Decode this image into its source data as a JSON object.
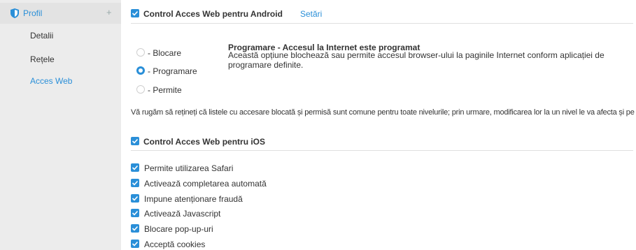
{
  "sidebar": {
    "title": "Profil",
    "plus": "+",
    "items": [
      {
        "label": "Detalii"
      },
      {
        "label": "Rețele"
      },
      {
        "label": "Acces Web"
      }
    ]
  },
  "android": {
    "title": "Control Acces Web pentru Android",
    "settings_link": "Setări",
    "radios": [
      {
        "label": "- Blocare",
        "selected": false
      },
      {
        "label": "- Programare",
        "selected": true
      },
      {
        "label": "- Permite",
        "selected": false
      }
    ],
    "schedule_title": "Programare - Accesul la Internet este programat",
    "schedule_desc": "Această opțiune blochează sau permite accesul browser-ului la paginile Internet conform aplicației de programare definite.",
    "note": "Vă rugăm să rețineți că listele cu accesare blocată și permisă sunt comune pentru toate nivelurile; prin urmare, modificarea lor la un nivel le va afecta și pe celelalte."
  },
  "ios": {
    "title": "Control Acces Web pentru iOS",
    "options": [
      {
        "label": "Permite utilizarea Safari",
        "checked": true
      },
      {
        "label": "Activează completarea automată",
        "checked": true
      },
      {
        "label": "Impune atenționare fraudă",
        "checked": true
      },
      {
        "label": "Activează Javascript",
        "checked": true
      },
      {
        "label": "Blocare pop-up-uri",
        "checked": true
      },
      {
        "label": "Acceptă cookies",
        "checked": true
      }
    ]
  },
  "colors": {
    "accent": "#2a8fd8",
    "sidebar_bg": "#ececec"
  }
}
